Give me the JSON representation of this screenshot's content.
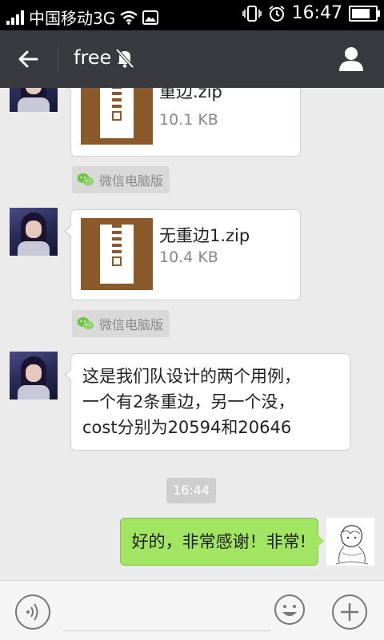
{
  "status_bar": {
    "carrier": "中国移动3G",
    "time": "16:47",
    "battery_level": 0.9
  },
  "header": {
    "title": "free",
    "icons": [
      "back-arrow-icon",
      "mute-bell-icon",
      "person-icon"
    ]
  },
  "messages": [
    {
      "type": "file",
      "direction": "received",
      "file_name": "重边.zip",
      "file_size": "10.1 KB",
      "source_tag": "微信电脑版"
    },
    {
      "type": "file",
      "direction": "received",
      "file_name": "无重边1.zip",
      "file_size": "10.4 KB",
      "source_tag": "微信电脑版"
    },
    {
      "type": "text",
      "direction": "received",
      "lines": [
        "这是我们队设计的两个用例，",
        "一个有2条重边，另一个没，",
        "cost分别为20594和20646"
      ]
    },
    {
      "type": "time",
      "text": "16:44"
    },
    {
      "type": "text",
      "direction": "sent",
      "text": "好的，非常感谢！非常!"
    }
  ],
  "input_bar": {
    "placeholder": "",
    "icons": [
      "voice-icon",
      "emoji-icon",
      "plus-icon"
    ]
  },
  "colors": {
    "header_bg": "#393a3f",
    "chat_bg": "#ebebeb",
    "sent_bubble": "#a2e563",
    "file_icon": "#8b5a2b"
  }
}
